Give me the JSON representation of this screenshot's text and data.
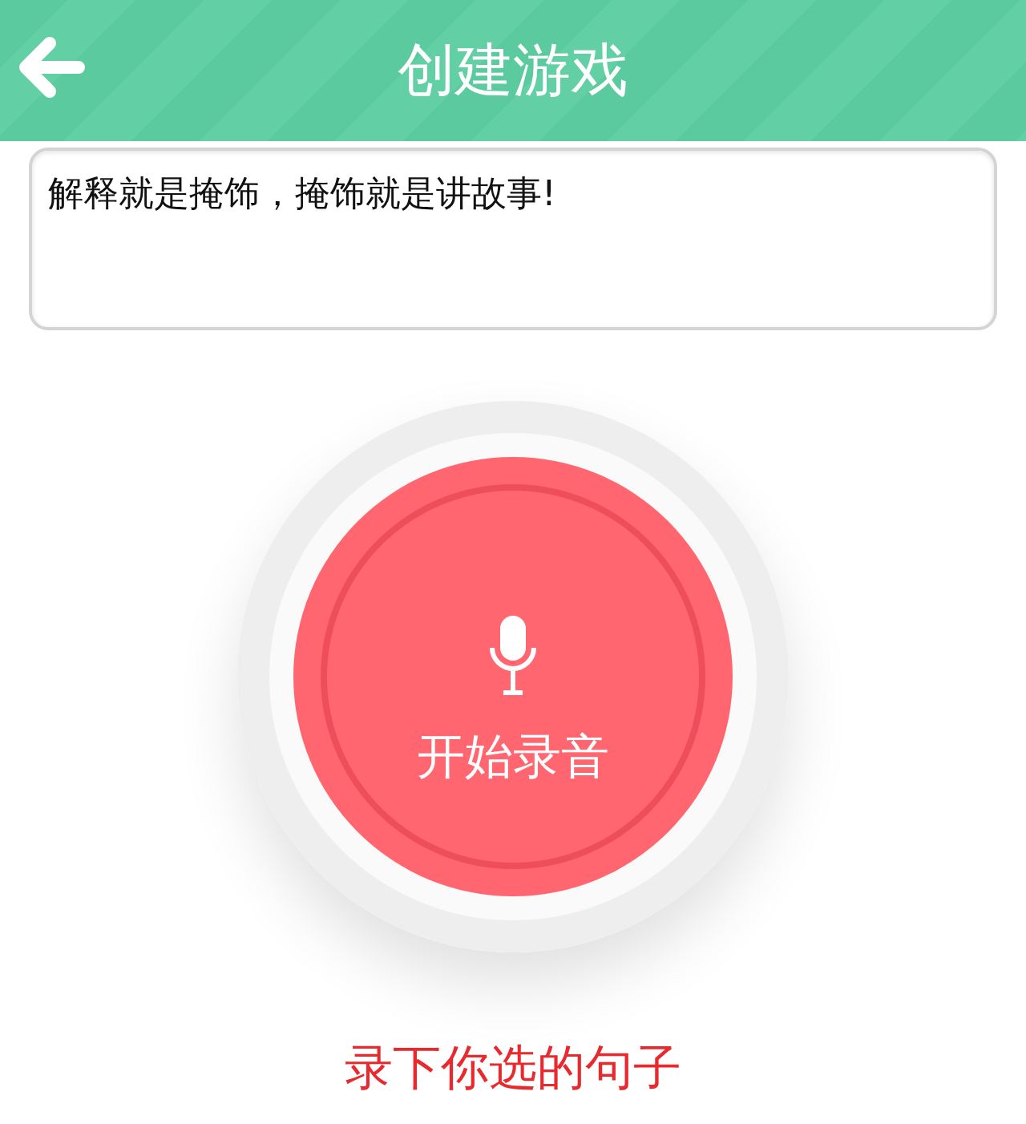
{
  "header": {
    "title": "创建游戏"
  },
  "sentence_field": {
    "value": "解释就是掩饰，掩饰就是讲故事!"
  },
  "record_button": {
    "label": "开始录音"
  },
  "hint": "录下你选的句子"
}
